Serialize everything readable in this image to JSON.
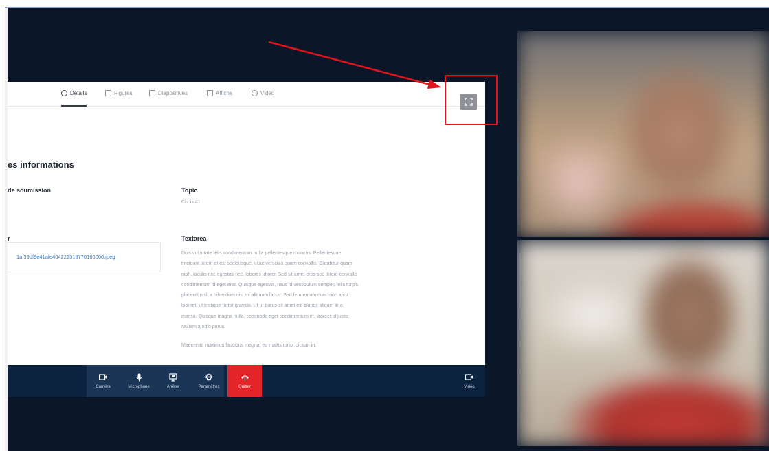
{
  "tabs": [
    {
      "label": "Détails",
      "icon": "info-circle-icon",
      "active": true
    },
    {
      "label": "Figures",
      "icon": "image-icon",
      "active": false
    },
    {
      "label": "Diapositives",
      "icon": "monitor-icon",
      "active": false
    },
    {
      "label": "Affiche",
      "icon": "poster-icon",
      "active": false
    },
    {
      "label": "Vidéo",
      "icon": "play-circle-icon",
      "active": false
    }
  ],
  "document": {
    "section_title": "es informations",
    "submission_label": "de soumission",
    "topic_label": "Topic",
    "topic_value": "Choix #1",
    "file_label": "r",
    "file_name": "1af39df9e41afe40422251877016600​0.jpeg",
    "textarea_label": "Textarea",
    "textarea_p1": "Duis vulputate felis condimentum nulla pellentesque rhoncus. Pellentesque tincidunt lorem et est scelerisque, vitae vehicula quam convallis. Curabitur quam nibh, iaculis nec egestas nec, lobortis id orci. Sed sit amet eros sed lorem convallis condimentum id eget erat. Quisque egestas, risus id vestibulum semper, felis turpis placerat nisl, a bibendum nisl mi aliquam lacus. Sed fermentum nunc non arcu laoreet, ut tristique tortor gravida. Ut ut purus sit amet elit blandit aliquet in a massa. Quisque magna nulla, commodo eget condimentum et, laoreet id justo. Nullam a odio purus.",
    "textarea_p2": "Maecenas maximus faucibus magna, eu mattis tortor dictum in."
  },
  "controls": {
    "camera": "Caméra",
    "microphone": "Microphone",
    "stop": "Arrêter",
    "settings": "Paramètres",
    "quit": "Quitter",
    "video": "Vidéo"
  },
  "colors": {
    "background": "#0b1628",
    "control_bar": "#0c2340",
    "quit": "#e3252a",
    "highlight": "#e3131b",
    "link": "#3a78c2"
  }
}
